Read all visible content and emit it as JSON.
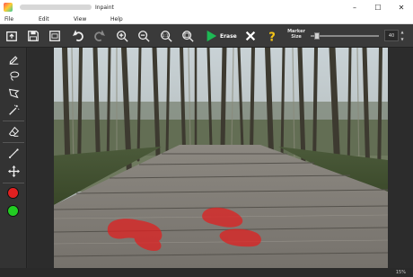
{
  "window": {
    "title": "Inpaint",
    "minimize": "–",
    "maximize": "☐",
    "close": "✕"
  },
  "menu": {
    "file": "File",
    "edit": "Edit",
    "view": "View",
    "help": "Help"
  },
  "toolbar": {
    "erase_label": "Erase",
    "marker_size_label": "Marker Size",
    "marker_size_value": "40",
    "marker_size_fraction": 0.05,
    "icons": [
      "open-icon",
      "save-icon",
      "save-as-icon",
      "undo-icon",
      "redo-icon",
      "zoom-in-icon",
      "zoom-out-icon",
      "zoom-actual-icon",
      "zoom-fit-icon",
      "play-icon",
      "cancel-icon",
      "help-icon"
    ]
  },
  "tools": [
    "marker-icon",
    "lasso-icon",
    "polygonal-lasso-icon",
    "magic-wand-icon",
    "eraser-icon",
    "guide-line-icon",
    "move-icon"
  ],
  "colors": {
    "accent_green": "#1db954",
    "marker_red": "#e02020",
    "swatch_green": "#22cc22",
    "help_yellow": "#f5c518"
  },
  "status": {
    "zoom": "15%"
  }
}
